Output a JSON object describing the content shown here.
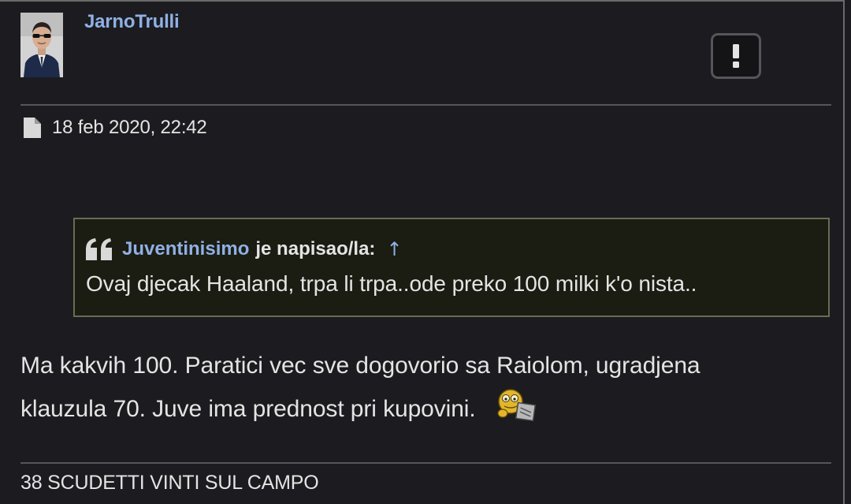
{
  "post": {
    "username": "JarnoTrulli",
    "avatar_icon": "user-avatar",
    "report_button_label": "!",
    "date_icon": "document-icon",
    "date": "18 feb 2020, 22:42",
    "quote": {
      "icon": "quote-icon",
      "author": "Juventinisimo",
      "wrote_label": "je napisao/la:",
      "jump_glyph": "↑",
      "text": "Ovaj djecak Haaland, trpa li trpa..ode preko 100 milki k'o nista.."
    },
    "body_lines": [
      "Ma kakvih 100. Paratici vec sve dogovorio sa Raiolom, ugradjena",
      "klauzula 70. Juve ima prednost pri kupovini."
    ],
    "smiley_icon": "smiley-sign-icon",
    "signature": "38 SCUDETTI VINTI SUL CAMPO"
  },
  "colors": {
    "background": "#1c1c20",
    "link": "#8fb1e4",
    "text": "#e4e4e4",
    "quote_background": "#1b1c12",
    "quote_border": "#6b6b54",
    "divider": "#55555a"
  }
}
